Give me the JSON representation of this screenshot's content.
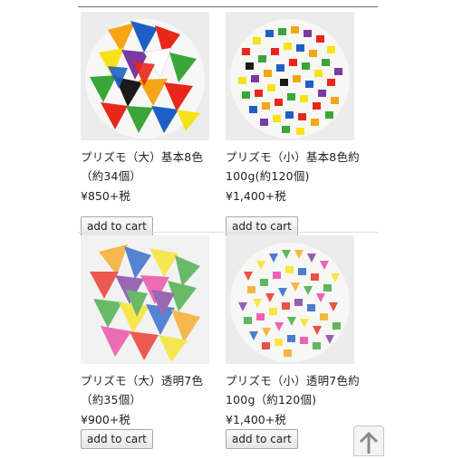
{
  "products": [
    {
      "name": "プリズモ（大）基本8色（約34個）",
      "price": "¥850+税",
      "button_label": "add to cart",
      "image_icon": "prism-pieces-large-basic-image"
    },
    {
      "name": "プリズモ（小）基本8色約100g(約120個)",
      "price": "¥1,400+税",
      "button_label": "add to cart",
      "image_icon": "prism-pieces-small-basic-image"
    },
    {
      "name": "プリズモ（大）透明7色（約35個）",
      "price": "¥900+税",
      "button_label": "add to cart",
      "image_icon": "prism-pieces-large-clear-image"
    },
    {
      "name": "プリズモ（小）透明7色約100g（約120個)",
      "price": "¥1,400+税",
      "button_label": "add to cart",
      "image_icon": "prism-pieces-small-clear-image"
    }
  ],
  "scroll_top_icon": "arrow-up-icon",
  "colors": {
    "divider": "#e2e2e2",
    "button_border": "#a8a8a8",
    "piece_colors": [
      "#e8271b",
      "#f5a516",
      "#f7e21a",
      "#3aa63a",
      "#1f5fc4",
      "#7a3aa0",
      "#1a1a1a",
      "#ffffff"
    ]
  }
}
